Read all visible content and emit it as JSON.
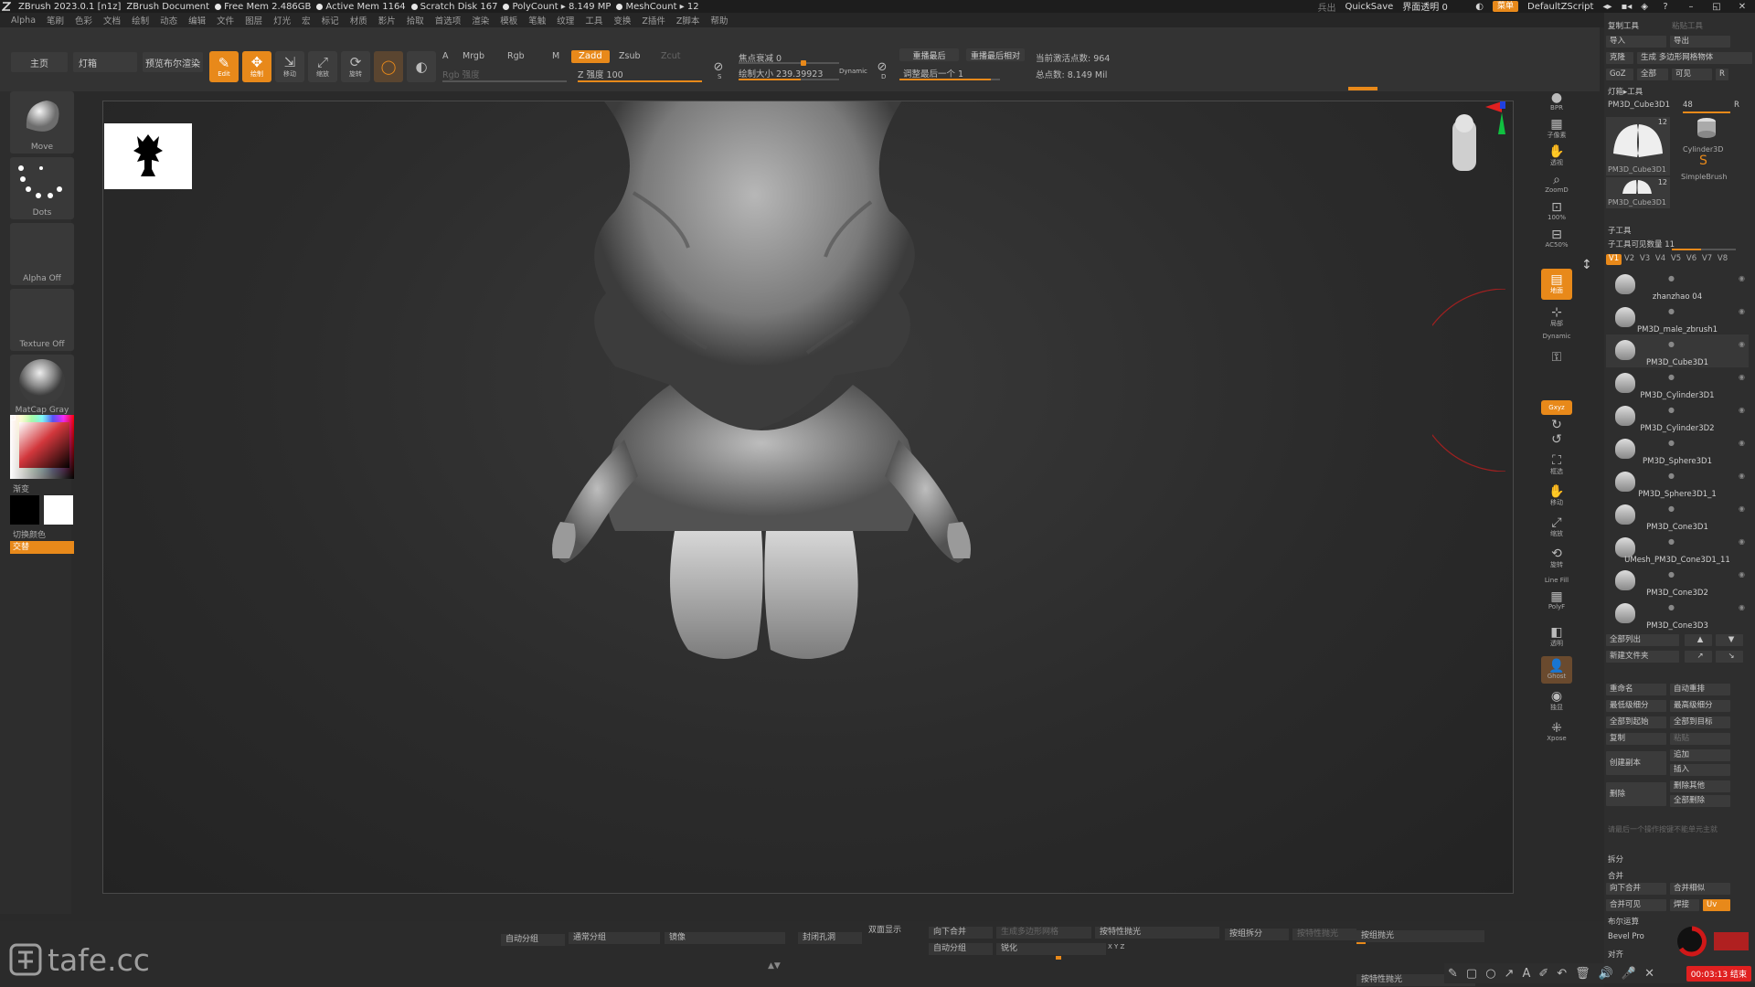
{
  "titlebar": {
    "app": "ZBrush 2023.0.1 [n1z]",
    "doc": "ZBrush Document",
    "free_mem": "Free Mem 2.486GB",
    "active_mem": "Active Mem 1164",
    "scratch": "Scratch Disk 167",
    "polycount": "PolyCount ▸ 8.149 MP",
    "meshcount": "MeshCount ▸ 12",
    "ai": "兵出",
    "quicksave": "QuickSave",
    "interface_opacity": "界面透明 0",
    "menus": "菜单",
    "script": "DefaultZScript"
  },
  "menubar": [
    "Alpha",
    "笔刷",
    "色彩",
    "文档",
    "绘制",
    "动态",
    "编辑",
    "文件",
    "图层",
    "灯光",
    "宏",
    "标记",
    "材质",
    "影片",
    "拾取",
    "首选项",
    "渲染",
    "模板",
    "笔触",
    "纹理",
    "工具",
    "变换",
    "Z插件",
    "Z脚本",
    "帮助"
  ],
  "shelf": {
    "home": "主页",
    "lightbox": "灯箱",
    "bpr": "预览布尔渲染",
    "edit": "Edit",
    "draw": "绘制",
    "move": "移动",
    "scale": "缩放",
    "rotate": "旋转",
    "a": "A",
    "mrgb": "Mrgb",
    "rgb": "Rgb",
    "m": "M",
    "zadd": "Zadd",
    "zsub": "Zsub",
    "zcut": "Zcut",
    "rgb_intensity": "Rgb 强度",
    "z_intensity": "Z 强度 100",
    "focal_shift": "焦点衰减 0",
    "draw_size": "绘制大小 239.39923",
    "dynamic": "Dynamic",
    "replay_last": "重播最后",
    "replay_last_rel": "重播最后相对",
    "adjust_last": "调整最后一个 1",
    "active_points": "当前激活点数: 964",
    "total_points": "总点数: 8.149 Mil",
    "s_label": "S",
    "d_label": "D"
  },
  "leftpanel": {
    "brush": "Move",
    "stroke": "Dots",
    "alpha": "Alpha Off",
    "texture": "Texture Off",
    "material": "MatCap Gray",
    "gradient": "渐变",
    "switch_color": "切换颜色",
    "alternate": "交替"
  },
  "iconcol": [
    {
      "icon": "sphere",
      "label": "BPR"
    },
    {
      "icon": "grid",
      "label": "子像素"
    },
    {
      "icon": "hand",
      "label": "透视"
    },
    {
      "icon": "zoom",
      "label": "ZoomD"
    },
    {
      "icon": "100",
      "label": "100%"
    },
    {
      "icon": "ac50",
      "label": "AC50%"
    },
    {
      "icon": "floor",
      "label": "地面"
    },
    {
      "icon": "local",
      "label": "局部"
    },
    {
      "icon": "dynamic",
      "label": "Dynamic"
    },
    {
      "icon": "xyz",
      "label": "Gxyz"
    },
    {
      "icon": "frame",
      "label": "框选"
    },
    {
      "icon": "move",
      "label": "移动"
    },
    {
      "icon": "zoom3d",
      "label": "缩放"
    },
    {
      "icon": "rotate",
      "label": "旋转"
    },
    {
      "icon": "linefill",
      "label": "Line Fill"
    },
    {
      "icon": "polyf",
      "label": "PolyF"
    },
    {
      "icon": "transp",
      "label": "透明"
    },
    {
      "icon": "ghost",
      "label": "Ghost"
    },
    {
      "icon": "solo",
      "label": "独显"
    },
    {
      "icon": "xpose",
      "label": "Xpose"
    }
  ],
  "rpanel": {
    "copy_tool": "复制工具",
    "paste_tool": "粘贴工具",
    "import": "导入",
    "export": "导出",
    "clone": "克隆",
    "make_polymesh": "生成 多边形网格物体",
    "goz": "GoZ",
    "all": "全部",
    "visible": "可见",
    "r": "R",
    "lightbox_tool": "灯箱▸工具",
    "current_tool": "PM3D_Cube3D1",
    "current_tool_count": "48",
    "tool_thumbs": [
      {
        "name": "PM3D_Cube3D1",
        "count": "12"
      },
      {
        "name": "Cylinder3D",
        "count": ""
      },
      {
        "name": "SimpleBrush",
        "count": ""
      },
      {
        "name": "PM3D_Cube3D1",
        "count": "12"
      }
    ],
    "subtool_title": "子工具",
    "subtool_count": "子工具可见数量 11",
    "versions": [
      "V1",
      "V2",
      "V3",
      "V4",
      "V5",
      "V6",
      "V7",
      "V8"
    ],
    "subtools": [
      "zhanzhao 04",
      "PM3D_male_zbrush1",
      "PM3D_Cube3D1",
      "PM3D_Cylinder3D1",
      "PM3D_Cylinder3D2",
      "PM3D_Sphere3D1",
      "PM3D_Sphere3D1_1",
      "PM3D_Cone3D1",
      "UMesh_PM3D_Cone3D1_11",
      "PM3D_Cone3D2",
      "PM3D_Cone3D3"
    ],
    "list_all": "全部列出",
    "new_folder": "新建文件夹",
    "rename": "重命名",
    "auto_reorder": "自动重排",
    "lowest_subdiv": "最低级细分",
    "highest_subdiv": "最高级细分",
    "all_low": "全部到起始",
    "all_high": "全部到目标",
    "duplicate": "复制",
    "mirror": "粘贴",
    "create_instance": "创建副本",
    "append": "追加",
    "insert": "插入",
    "delete": "删除",
    "delete_other": "删除其他",
    "delete_all": "全部删除",
    "hint": "请最后一个操作按键不能单元主就",
    "split": "拆分",
    "merge": "合并",
    "merge_down": "向下合并",
    "merge_similar": "合并相似",
    "merge_visible": "合并可见",
    "weld": "焊接",
    "uv": "Uv",
    "boolean": "布尔运算",
    "bevel_pro": "Bevel Pro",
    "align": "对齐"
  },
  "bottombar": {
    "auto_group": "自动分组",
    "group_split": "通常分组",
    "mirror": "镜像",
    "close_holes": "封闭孔洞",
    "double": "双面显示",
    "merge_down": "向下合并",
    "gen_polymesh": "生成多边形网格",
    "by_polygroup": "按特性抛光",
    "group_split2": "按组拆分",
    "visible_fill": "按特性抛光",
    "auto_group2": "自动分组",
    "sharpen": "锐化",
    "group_polish": "按组抛光",
    "xyz": "X Y Z",
    "by_feature": "按特性抛光",
    "record_time": "00:03:13 结束"
  },
  "watermark": "tafe.cc",
  "colors": {
    "accent": "#e8891a",
    "bg": "#2a2a2a",
    "panel": "#2e2e2e"
  }
}
